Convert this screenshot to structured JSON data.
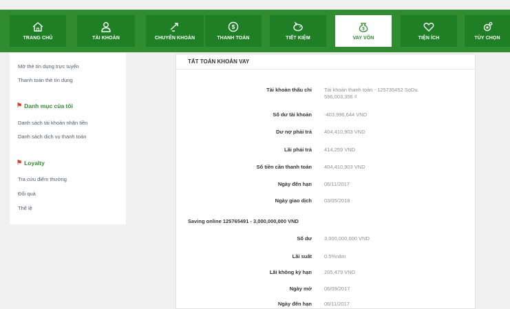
{
  "nav": {
    "tabs": [
      {
        "label": "TRANG CHỦ",
        "icon": "home-icon"
      },
      {
        "label": "TÀI KHOẢN",
        "icon": "user-icon"
      },
      {
        "label": "CHUYỂN KHOẢN",
        "icon": "transfer-icon"
      },
      {
        "label": "THANH TOÁN",
        "icon": "dollar-coin-icon"
      },
      {
        "label": "TIẾT KIỆM",
        "icon": "piggy-bank-icon"
      },
      {
        "label": "VAY VỐN",
        "icon": "money-bag-icon"
      },
      {
        "label": "TIỆN ÍCH",
        "icon": "heart-icon"
      },
      {
        "label": "TÙY CHỌN",
        "icon": "settings-icon"
      }
    ],
    "active": "VAY VỐN"
  },
  "sidebar": {
    "cards_links": [
      "Mở thẻ tín dụng trực tuyến",
      "Thanh toán thẻ tín dụng"
    ],
    "my_list_heading": "Danh mục của tôi",
    "my_list_links": [
      "Danh sách tài khoản nhận tiền",
      "Danh sách dịch vụ thanh toán"
    ],
    "loyalty_heading": "Loyalty",
    "loyalty_links": [
      "Tra cứu điểm thưởng",
      "Đổi quà",
      "Thể lệ"
    ]
  },
  "panel": {
    "title": "TẤT TOÁN KHOẢN VAY",
    "loan_rows": [
      {
        "label": "Tài khoản thấu chi",
        "value": "Tài khoản thanh toán - 125735452 SoDu.",
        "value2": "596,003,356 ₫"
      },
      {
        "label": "Số dư tài khoản",
        "value": "-403,996,644 VND"
      },
      {
        "label": "Dư nợ phải trả",
        "value": "404,410,903 VND"
      },
      {
        "label": "Lãi phải trả",
        "value": "414,259 VND"
      },
      {
        "label": "Số tiền cần thanh toán",
        "value": "404,410,903 VND"
      },
      {
        "label": "Ngày đến hạn",
        "value": "06/11/2017"
      },
      {
        "label": "Ngày giao dịch",
        "value": "03/05/2018"
      }
    ],
    "saving_title": "Saving online 125765491 - 3,000,000,000 VND",
    "saving_rows": [
      {
        "label": "Số dư",
        "value": "3,000,000,000 VND"
      },
      {
        "label": "Lãi suất",
        "value": "0.5%năm"
      },
      {
        "label": "Lãi không kỳ hạn",
        "value": "205,479 VND"
      },
      {
        "label": "Ngày mở",
        "value": "06/09/2017"
      },
      {
        "label": "Ngày đến hạn",
        "value": "06/11/2017"
      }
    ]
  },
  "colors": {
    "brand_green": "#2f8d2f",
    "tab_green": "#1f7f25",
    "flag_red": "#e0331b",
    "value_grey": "#8a8f96"
  }
}
